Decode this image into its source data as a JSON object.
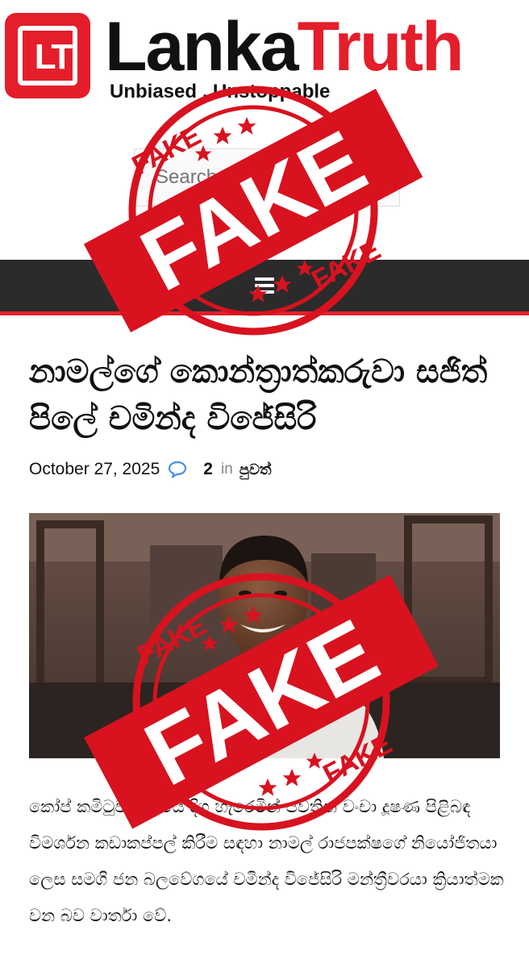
{
  "site": {
    "logo_mark": "LT",
    "brand_first": "Lanka",
    "brand_second": "Truth",
    "tagline": "Unbiased , Unstoppable"
  },
  "search": {
    "placeholder": "Search the..."
  },
  "nav": {
    "menu_icon": "hamburger-menu-icon"
  },
  "article": {
    "title": "නාමල්ගේ කොන්ත්‍රාත්කරුවා සජිත් පිලේ චමින්ද විජේසිරි",
    "date": "October 27, 2025",
    "comment_count": "2",
    "in_label": "in",
    "category": "පුවත්",
    "body": "කෝප් කමිටුව ඉදිරියේ දිග හැරෙමින් පවතින වංචා දූෂණ පිළිබඳ විමර්ශන කඩාකප්පල් කිරීම සඳහා නාමල් රාජපක්ෂගේ නියෝජිතයා ලෙස සමගි ජන බලවේගයේ චමින්ද විජේසිරි මන්ත්‍රීවරයා ක්‍රියාත්මක වන බව වාර්තා වේ."
  },
  "stamps": {
    "main_label": "FAKE",
    "ring_label": "FAKE",
    "color": "#d8121f"
  },
  "colors": {
    "accent": "#e41e2b",
    "nav_bg": "#2b2b2b",
    "comment_icon": "#4a90e2"
  }
}
